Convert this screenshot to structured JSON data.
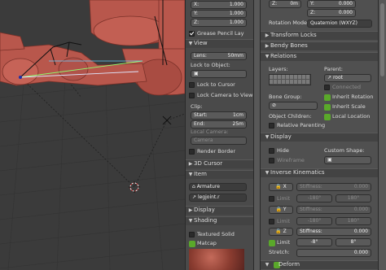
{
  "npanel": {
    "loc_x_label": "X:",
    "loc_x_value": "1.000",
    "loc_y_label": "Y:",
    "loc_y_value": "1.000",
    "loc_z_label": "Z:",
    "loc_z_value": "1.000",
    "grease_pencil_label": "Grease Pencil Lay",
    "view_header": "View",
    "lens_label": "Lens:",
    "lens_value": "50mm",
    "lock_to_object_label": "Lock to Object:",
    "lock_to_cursor_label": "Lock to Cursor",
    "lock_camera_label": "Lock Camera to View",
    "clip_label": "Clip:",
    "clip_start_label": "Start:",
    "clip_start_value": "1cm",
    "clip_end_label": "End:",
    "clip_end_value": "25m",
    "local_camera_label": "Local Camera:",
    "camera_field": "Camera",
    "render_border_label": "Render Border",
    "cursor_header": "3D Cursor",
    "item_header": "Item",
    "item_armature": "Armature",
    "item_bone": "legjoint.r",
    "display_header": "Display",
    "shading_header": "Shading",
    "textured_solid_label": "Textured Solid",
    "matcap_label": "Matcap"
  },
  "props": {
    "top_z_label": "Z:",
    "top_z_value": "0m",
    "top_y_label": "Y:",
    "top_y_value": "0.000",
    "top_z2_label": "Z:",
    "top_z2_value": "0.000",
    "rotation_mode_label": "Rotation Mode:",
    "rotation_mode_value": "Quaternion (WXYZ)",
    "transform_locks_header": "Transform Locks",
    "bendy_bones_header": "Bendy Bones",
    "relations_header": "Relations",
    "layers_label": "Layers:",
    "parent_label": "Parent:",
    "parent_value": "root",
    "connected_label": "Connected",
    "inherit_rotation_label": "Inherit Rotation",
    "inherit_scale_label": "Inherit Scale",
    "local_location_label": "Local Location",
    "bone_group_label": "Bone Group:",
    "object_children_label": "Object Children:",
    "relative_parenting_label": "Relative Parenting",
    "display_header": "Display",
    "hide_label": "Hide",
    "wireframe_label": "Wireframe",
    "custom_shape_label": "Custom Shape:",
    "ik_header": "Inverse Kinematics",
    "ik_x": "X",
    "ik_y": "Y",
    "ik_z": "Z",
    "stiffness_label": "Stiffness:",
    "stiffness_x": "0.000",
    "stiffness_y": "0.000",
    "stiffness_z": "0.000",
    "limit_label": "Limit",
    "limit_x_min": "-180°",
    "limit_x_max": "180°",
    "limit_y_min": "-180°",
    "limit_y_max": "180°",
    "limit_z_min": "-8°",
    "limit_z_max": "8°",
    "stretch_label": "Stretch:",
    "stretch_value": "0.000",
    "deform_header": "Deform"
  },
  "colors": {
    "viewport_bg": "#3b3b3b",
    "panel_bg": "#4a4a4a",
    "props_bg": "#505050",
    "mesh": "#b8574c",
    "check_green": "#5aa82a"
  }
}
